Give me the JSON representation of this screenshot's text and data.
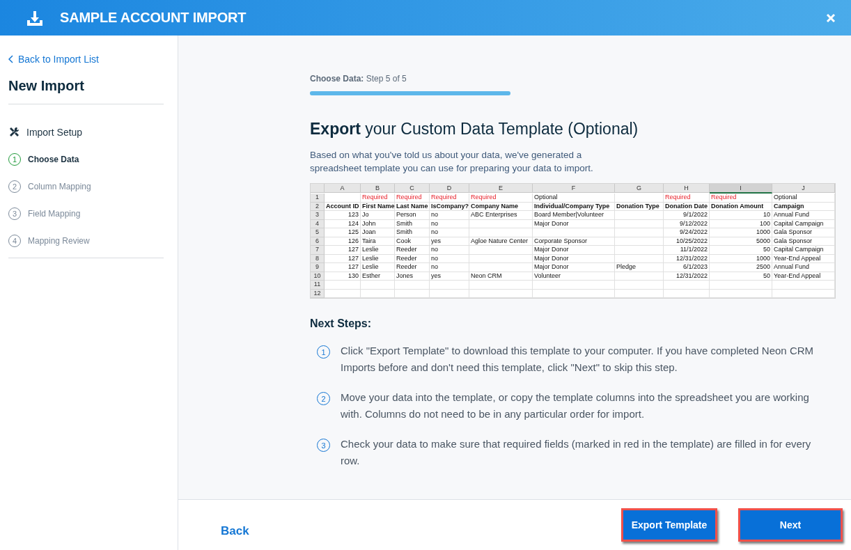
{
  "header": {
    "title": "SAMPLE ACCOUNT IMPORT"
  },
  "sidebar": {
    "back_link": "Back to Import List",
    "title": "New Import",
    "items": [
      {
        "kind": "section",
        "label": "Import Setup",
        "selected": false
      },
      {
        "kind": "step",
        "number": "1",
        "label": "Choose Data",
        "selected": true
      },
      {
        "kind": "step",
        "number": "2",
        "label": "Column Mapping",
        "selected": false
      },
      {
        "kind": "step",
        "number": "3",
        "label": "Field Mapping",
        "selected": false
      },
      {
        "kind": "step",
        "number": "4",
        "label": "Mapping Review",
        "selected": false
      }
    ]
  },
  "progress": {
    "label": "Choose Data:",
    "step": "Step 5 of 5",
    "level": 1
  },
  "heading": "**Export** your Custom Data Template (Optional)",
  "intro": "Based on what you've told us about your data, we've generated a spreadsheet template you can use for preparing your data to import.",
  "spreadsheet": {
    "columns": [
      {
        "letter": "A",
        "selected": false,
        "kind": "number"
      },
      {
        "letter": "B",
        "selected": false,
        "kind": "text"
      },
      {
        "letter": "C",
        "selected": false,
        "kind": "text"
      },
      {
        "letter": "D",
        "selected": false,
        "kind": "text"
      },
      {
        "letter": "E",
        "selected": false,
        "kind": "text"
      },
      {
        "letter": "F",
        "selected": false,
        "kind": "text"
      },
      {
        "letter": "G",
        "selected": false,
        "kind": "text"
      },
      {
        "letter": "H",
        "selected": false,
        "kind": "number"
      },
      {
        "letter": "I",
        "selected": true,
        "kind": "number"
      },
      {
        "letter": "J",
        "selected": false,
        "kind": "text"
      }
    ],
    "requirement_row": {
      "number": "1",
      "cells": [
        {
          "kind": "blank"
        },
        {
          "kind": "required",
          "text": "Required"
        },
        {
          "kind": "required",
          "text": "Required"
        },
        {
          "kind": "required",
          "text": "Required"
        },
        {
          "kind": "required",
          "text": "Required"
        },
        {
          "kind": "optional",
          "text": "Optional"
        },
        {
          "kind": "blank"
        },
        {
          "kind": "required",
          "text": "Required"
        },
        {
          "kind": "required",
          "text": "Required"
        },
        {
          "kind": "optional",
          "text": "Optional"
        }
      ]
    },
    "header_row": {
      "number": "2",
      "cells": [
        "Account ID",
        "First Name",
        "Last Name",
        "IsCompany?",
        "Company Name",
        "Individual/Company Type",
        "Donation Type",
        "Donation Date",
        "Donation Amount",
        "Campaign"
      ]
    },
    "rows": [
      {
        "number": "3",
        "cells": [
          "123",
          "Jo",
          "Person",
          "no",
          "ABC Enterprises",
          "Board Member|Volunteer",
          null,
          "9/1/2022",
          "10",
          "Annual Fund"
        ]
      },
      {
        "number": "4",
        "cells": [
          "124",
          "John",
          "Smith",
          "no",
          null,
          "Major Donor",
          null,
          "9/12/2022",
          "100",
          "Capital Campaign"
        ]
      },
      {
        "number": "5",
        "cells": [
          "125",
          "Joan",
          "Smith",
          "no",
          null,
          null,
          null,
          "9/24/2022",
          "1000",
          "Gala Sponsor"
        ]
      },
      {
        "number": "6",
        "cells": [
          "126",
          "Taira",
          "Cook",
          "yes",
          "Agloe Nature Center",
          "Corporate Sponsor",
          null,
          "10/25/2022",
          "5000",
          "Gala Sponsor"
        ]
      },
      {
        "number": "7",
        "cells": [
          "127",
          "Leslie",
          "Reeder",
          "no",
          null,
          "Major Donor",
          null,
          "11/1/2022",
          "50",
          "Capital Campaign"
        ]
      },
      {
        "number": "8",
        "cells": [
          "127",
          "Leslie",
          "Reeder",
          "no",
          null,
          "Major Donor",
          null,
          "12/31/2022",
          "1000",
          "Year-End Appeal"
        ]
      },
      {
        "number": "9",
        "cells": [
          "127",
          "Leslie",
          "Reeder",
          "no",
          null,
          "Major Donor",
          "Pledge",
          "6/1/2023",
          "2500",
          "Annual Fund"
        ]
      },
      {
        "number": "10",
        "cells": [
          "130",
          "Esther",
          "Jones",
          "yes",
          "Neon CRM",
          "Volunteer",
          null,
          "12/31/2022",
          "50",
          "Year-End Appeal"
        ]
      },
      {
        "number": "11"
      },
      {
        "number": "12"
      }
    ]
  },
  "next_steps": {
    "title": "Next Steps:",
    "items": [
      {
        "number": "1",
        "text": "Click \"Export Template\" to download this template to your computer. If you have completed Neon CRM Imports before and don't need this template, click \"Next\" to skip this step."
      },
      {
        "number": "2",
        "text": "Move your data into the template, or copy the template columns into the spreadsheet you are working with. Columns do not need to be in any particular order for import."
      },
      {
        "number": "3",
        "text": "Check your data to make sure that required fields (marked in red in the template) are filled in for every row."
      }
    ]
  },
  "footer": {
    "back": "Back",
    "buttons": [
      {
        "label": "Export Template",
        "highlighted": true
      },
      {
        "label": "Next",
        "highlighted": true
      }
    ]
  }
}
